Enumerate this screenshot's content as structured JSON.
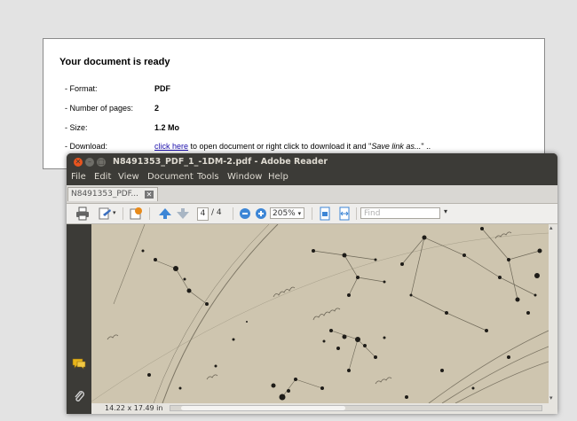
{
  "page": {
    "title": "Your document is ready",
    "rows": [
      {
        "label": "- Format:",
        "value": "PDF"
      },
      {
        "label": "- Number of pages:",
        "value": "2"
      },
      {
        "label": "- Size:",
        "value": "1.2 Mo"
      }
    ],
    "download": {
      "label": "- Download:",
      "link_text": "click here",
      "text_middle": " to open document or right click to download it and \"",
      "emphasis": "Save link as...",
      "text_end": "\" .."
    }
  },
  "reader": {
    "window_title": "N8491353_PDF_1_-1DM-2.pdf - Adobe Reader",
    "menu": [
      "File",
      "Edit",
      "View",
      "Document",
      "Tools",
      "Window",
      "Help"
    ],
    "tab_label": "N8491353_PDF...",
    "tab_close": "✕",
    "toolbar": {
      "current_page": "4",
      "page_total": "/ 4",
      "zoom": "205%",
      "find_placeholder": "Find"
    },
    "status": {
      "page_size": "14.22 x 17.49 in"
    },
    "colors": {
      "titlebar": "#3c3b37",
      "close_button": "#e9541e",
      "map_paper": "#ccc3ad"
    },
    "icons": [
      "print-icon",
      "sign-icon",
      "share-icon",
      "prev-page-icon",
      "next-page-icon",
      "zoom-out-icon",
      "zoom-in-icon",
      "fit-page-icon",
      "fit-width-icon",
      "comment-icon",
      "attachment-icon"
    ]
  }
}
